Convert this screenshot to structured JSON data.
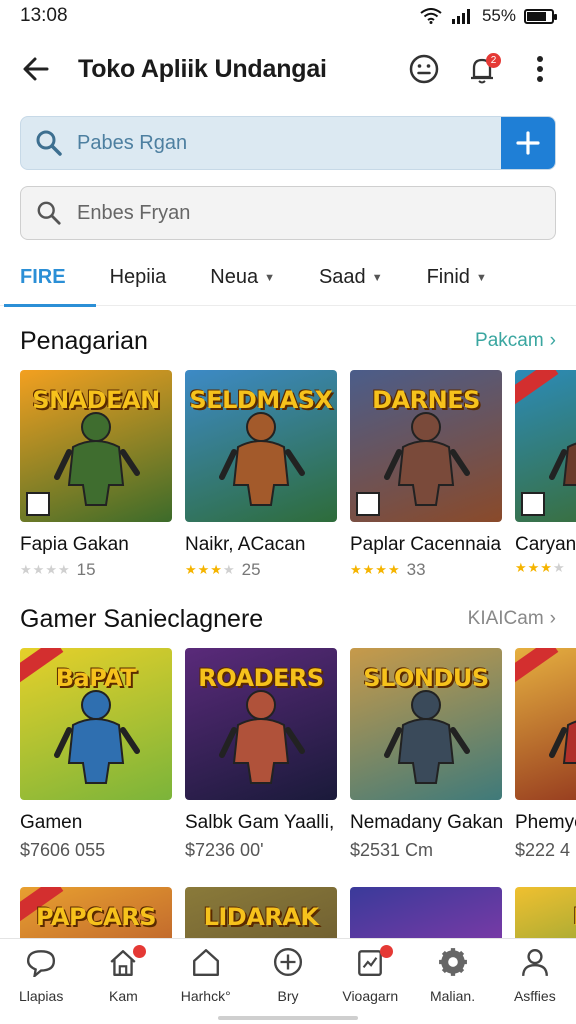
{
  "status": {
    "time": "13:08",
    "battery": "55%",
    "battery_level": 0.8
  },
  "header": {
    "title": "Toko Apliik Undangai",
    "back_icon": "arrow-left-icon",
    "actions": [
      "emoji-face-icon",
      "notification-bell-icon",
      "more-vert-icon"
    ],
    "bell_badge": "2"
  },
  "search_primary": {
    "placeholder": "Pabes Rgan",
    "action_icon": "plus-icon"
  },
  "search_secondary": {
    "placeholder": "Enbes Fryan"
  },
  "tabs": [
    {
      "label": "FIRE",
      "active": true,
      "dropdown": false
    },
    {
      "label": "Hepiia",
      "active": false,
      "dropdown": false
    },
    {
      "label": "Neua",
      "active": false,
      "dropdown": true
    },
    {
      "label": "Saad",
      "active": false,
      "dropdown": true
    },
    {
      "label": "Finid",
      "active": false,
      "dropdown": true
    }
  ],
  "colors": {
    "accent": "#2b8fd6",
    "section_link_1": "#3aa6a0",
    "section_link_2": "#888888",
    "star": "#f5b400"
  },
  "section1": {
    "title": "Penagarian",
    "link": "Pakcam",
    "cards": [
      {
        "art_text": "SNADEAN",
        "title": "Fapia Gakan",
        "rating": 0,
        "count": "15",
        "bg": [
          "#f3a020",
          "#3c6b2a"
        ],
        "figure": "#3f6d2f"
      },
      {
        "art_text": "SELDMASX",
        "title": "Naikr, ACacan",
        "rating": 3,
        "count": "25",
        "bg": [
          "#3d8ac6",
          "#2e6c3a"
        ],
        "figure": "#a35a2b"
      },
      {
        "art_text": "DARNES",
        "title": "Paplar Cacennaia,",
        "rating": 4,
        "count": "33",
        "bg": [
          "#4b5d8a",
          "#8a4a2a"
        ],
        "figure": "#7a4a3a"
      },
      {
        "art_text": "",
        "title": "Caryan",
        "rating": 3,
        "count": "",
        "bg": [
          "#2c8bb8",
          "#3b6b2d"
        ],
        "figure": "#6a3b2a"
      }
    ]
  },
  "section2": {
    "title": "Gamer Sanieclagnere",
    "link": "KIAICam",
    "cards": [
      {
        "art_text": "BaPAT",
        "title": "Gamen",
        "price": "$7606 055",
        "bg": [
          "#e6d02a",
          "#7bb43a"
        ],
        "figure": "#2f6fb0"
      },
      {
        "art_text": "ROADERS",
        "title": "Salbk Gam Yaalli,",
        "price": "$7236 00'",
        "bg": [
          "#5a2a7a",
          "#1a1a3a"
        ],
        "figure": "#b0523a"
      },
      {
        "art_text": "SLONDUS",
        "title": "Nemadany Gakan.",
        "price": "$2531 Cm",
        "bg": [
          "#c79a4a",
          "#3f7a7a"
        ],
        "figure": "#3a4a5a"
      },
      {
        "art_text": "",
        "title": "Phemyc",
        "price": "$222 4",
        "bg": [
          "#e6b040",
          "#8a2a1a"
        ],
        "figure": "#b0302a"
      }
    ]
  },
  "section3": {
    "cards": [
      {
        "art_text": "PAPCARS",
        "bg": [
          "#e8a030",
          "#a03a2a"
        ]
      },
      {
        "art_text": "LIDARAK",
        "bg": [
          "#8a7a3a",
          "#5a4a2a"
        ]
      },
      {
        "art_text": "",
        "bg": [
          "#3a3a9a",
          "#b03ab0"
        ]
      },
      {
        "art_text": "PU",
        "bg": [
          "#f0c030",
          "#3a8a3a"
        ]
      }
    ]
  },
  "bottom_nav": [
    {
      "label": "Llapias",
      "icon": "chat-bubble-icon"
    },
    {
      "label": "Kam",
      "icon": "home-badge-icon",
      "badge": true
    },
    {
      "label": "Harhck°",
      "icon": "home-icon"
    },
    {
      "label": "Bry",
      "icon": "add-circle-icon"
    },
    {
      "label": "Vioagarn",
      "icon": "chart-doc-icon",
      "badge": true
    },
    {
      "label": "Malian.",
      "icon": "settings-gear-icon"
    },
    {
      "label": "Asffies",
      "icon": "person-icon"
    }
  ]
}
